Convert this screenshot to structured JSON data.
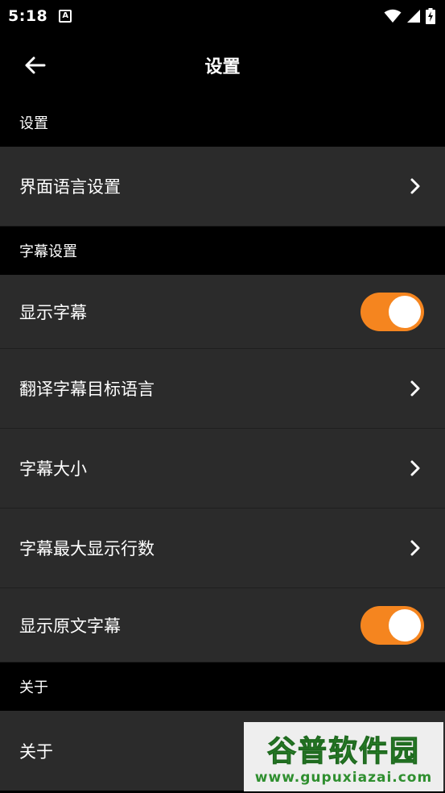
{
  "status_bar": {
    "time": "5:18",
    "notification_icon_letter": "A",
    "icons": [
      "wifi-icon",
      "signal-icon",
      "battery-charging-icon"
    ]
  },
  "toolbar": {
    "title": "设置",
    "back_icon": "arrow-left-icon"
  },
  "sections": [
    {
      "header": "设置",
      "items": [
        {
          "label": "界面语言设置",
          "control": "chevron"
        }
      ]
    },
    {
      "header": "字幕设置",
      "items": [
        {
          "label": "显示字幕",
          "control": "toggle",
          "on": true
        },
        {
          "label": "翻译字幕目标语言",
          "control": "chevron"
        },
        {
          "label": "字幕大小",
          "control": "chevron"
        },
        {
          "label": "字幕最大显示行数",
          "control": "chevron"
        },
        {
          "label": "显示原文字幕",
          "control": "toggle",
          "on": true
        }
      ]
    },
    {
      "header": "关于",
      "items": [
        {
          "label": "关于",
          "control": "none"
        }
      ]
    }
  ],
  "colors": {
    "background": "#000000",
    "row_background": "#2b2b2b",
    "toggle_on": "#f5851f",
    "text": "#ffffff"
  },
  "watermark": {
    "title": "谷普软件园",
    "url": "www.gupuxiazai.com"
  }
}
